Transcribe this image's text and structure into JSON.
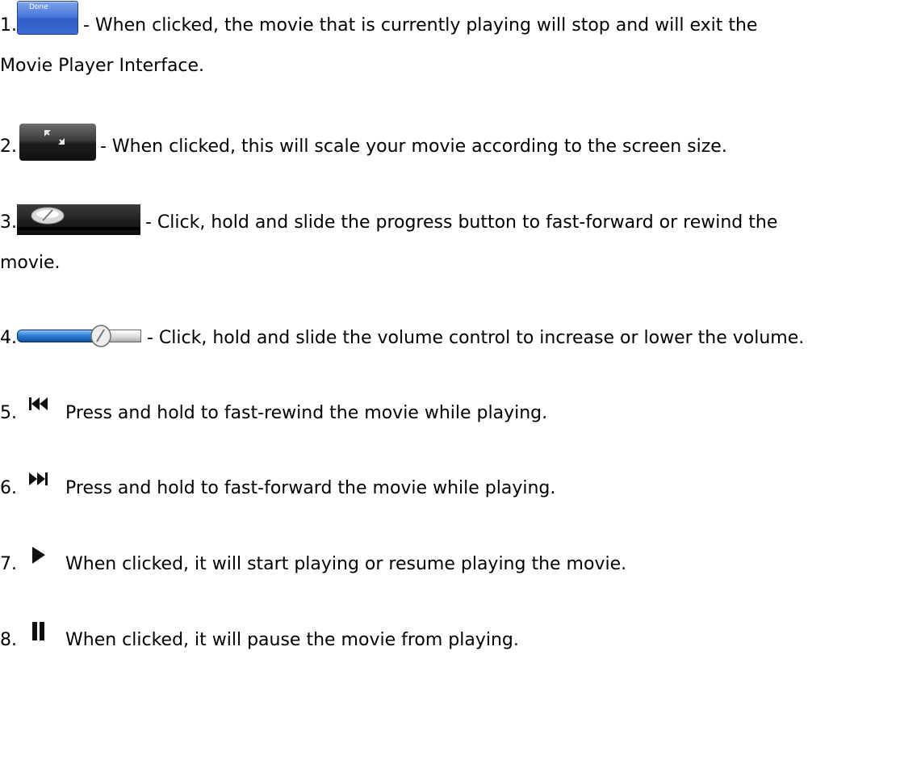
{
  "items": [
    {
      "number": "1.",
      "icon": "done-button-icon",
      "icon_label": "Done",
      "lines": [
        "- When clicked, the movie that is currently playing will stop and will exit the",
        "Movie Player Interface."
      ]
    },
    {
      "number": "2.",
      "icon": "scale-screen-icon",
      "lines": [
        "- When clicked, this will scale your movie according to the screen size."
      ]
    },
    {
      "number": "3.",
      "icon": "progress-slider-icon",
      "lines": [
        "- Click, hold and slide the progress button to fast-forward or rewind the",
        "movie."
      ]
    },
    {
      "number": "4.",
      "icon": "volume-slider-icon",
      "lines": [
        "- Click, hold and slide the volume control to increase or lower the volume."
      ]
    },
    {
      "number": "5.",
      "icon": "fast-rewind-icon",
      "lines": [
        "Press and hold to fast-rewind the movie while playing."
      ]
    },
    {
      "number": "6.",
      "icon": "fast-forward-icon",
      "lines": [
        "Press and hold to fast-forward the movie while playing."
      ]
    },
    {
      "number": "7.",
      "icon": "play-icon",
      "lines": [
        "When clicked, it will start playing or resume playing the movie."
      ]
    },
    {
      "number": "8.",
      "icon": "pause-icon",
      "lines": [
        "When clicked, it will pause the movie from playing."
      ]
    }
  ],
  "colors": {
    "text": "#000000",
    "background": "#ffffff",
    "done_button_blue": "#3a6ad2",
    "volume_blue": "#2f7fd6"
  }
}
